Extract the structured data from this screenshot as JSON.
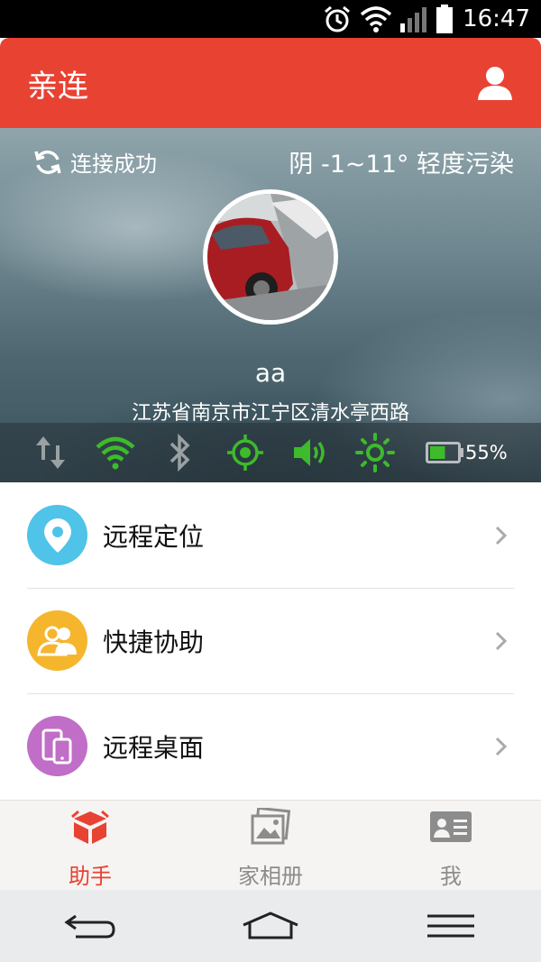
{
  "status_bar": {
    "time": "16:47",
    "icons": [
      "alarm-icon",
      "wifi-icon",
      "signal-icon",
      "battery-icon"
    ]
  },
  "header": {
    "title": "亲连",
    "profile_icon": "person-icon"
  },
  "hero": {
    "connection_status": "连接成功",
    "weather": "阴 -1~11° 轻度污染",
    "user_name": "aa",
    "address": "江苏省南京市江宁区清水亭西路",
    "indicators": [
      "data-transfer-icon",
      "wifi-icon",
      "bluetooth-icon",
      "gps-icon",
      "volume-icon",
      "brightness-icon",
      "battery-icon"
    ],
    "battery_percent": "55%",
    "battery_level": 0.55,
    "active_color": "#3dbb2b"
  },
  "menu": {
    "items": [
      {
        "label": "远程定位",
        "icon": "location-pin-icon",
        "color": "#4fc3e8"
      },
      {
        "label": "快捷协助",
        "icon": "users-icon",
        "color": "#f5b62e"
      },
      {
        "label": "远程桌面",
        "icon": "devices-icon",
        "color": "#c06ec7"
      }
    ]
  },
  "tabs": [
    {
      "label": "助手",
      "icon": "box-icon",
      "active": true
    },
    {
      "label": "家相册",
      "icon": "photo-album-icon",
      "active": false
    },
    {
      "label": "我",
      "icon": "id-card-icon",
      "active": false
    }
  ],
  "colors": {
    "accent": "#e84232",
    "tab_inactive": "#8c8c8c"
  }
}
